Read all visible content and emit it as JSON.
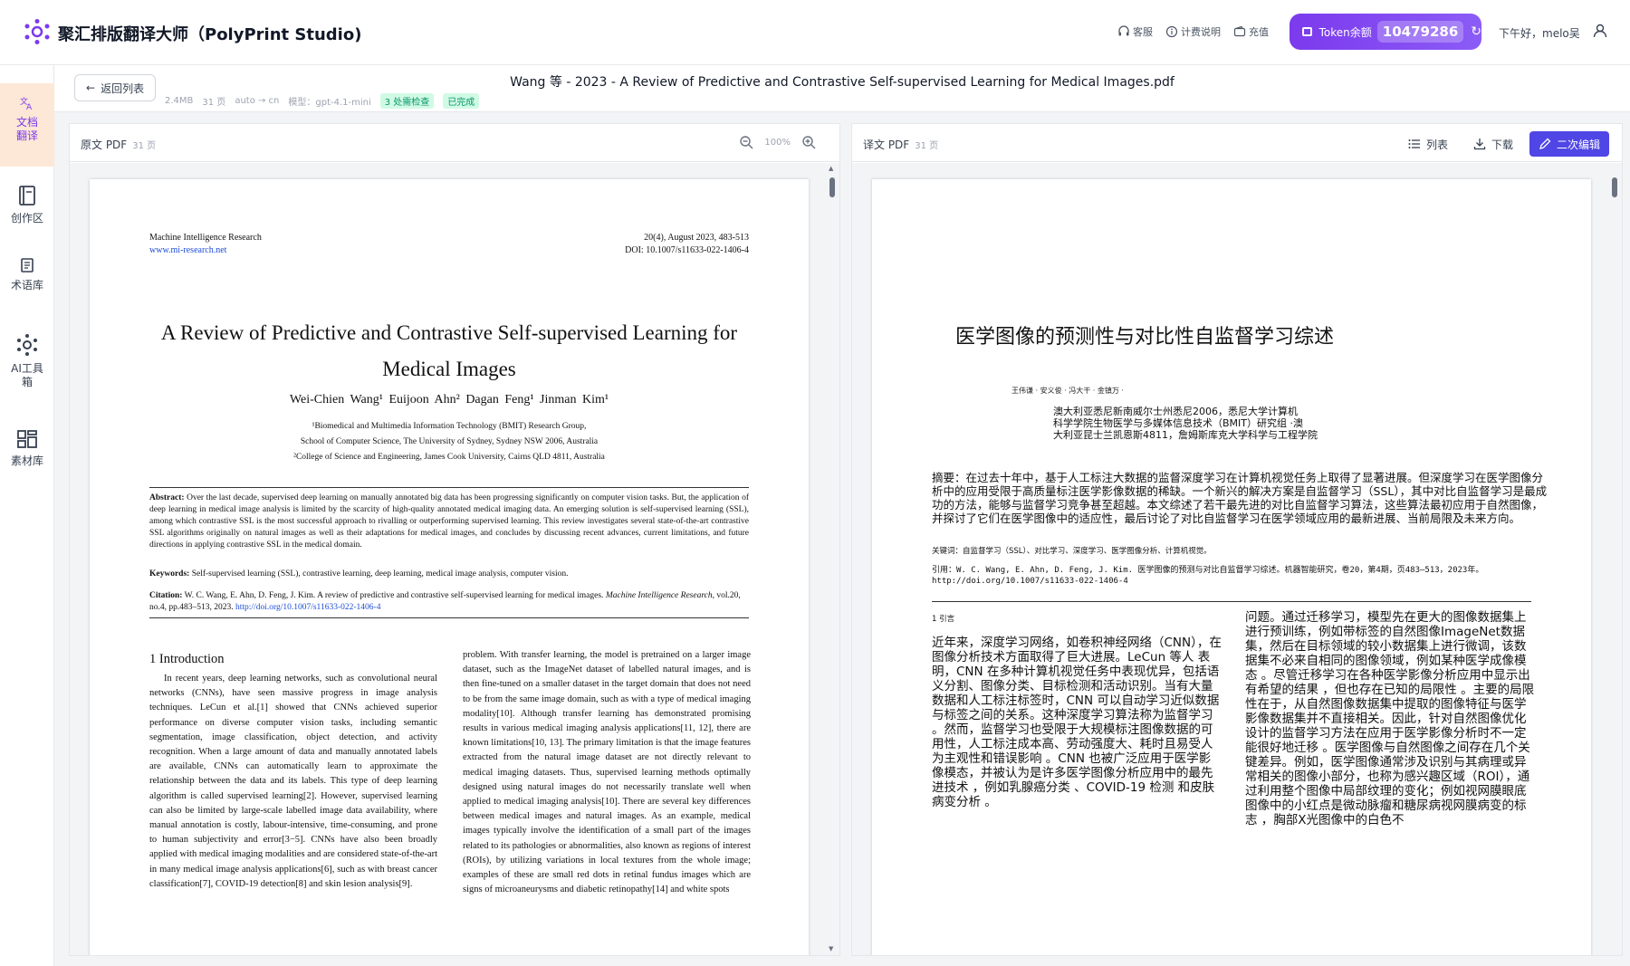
{
  "app": {
    "title": "聚汇排版翻译大师（PolyPrint Studio)",
    "links": [
      {
        "icon": "headset-icon",
        "label": "客服"
      },
      {
        "icon": "info-icon",
        "label": "计费说明"
      },
      {
        "icon": "wallet-icon",
        "label": "充值"
      }
    ],
    "token_label": "Token余额",
    "token_value": "10479286",
    "greeting": "下午好，melo吴"
  },
  "rail": [
    {
      "label": "文档翻译",
      "icon": "translate-icon",
      "active": true
    },
    {
      "label": "创作区",
      "icon": "notebook-icon"
    },
    {
      "label": "术语库",
      "icon": "glossary-icon"
    },
    {
      "label": "AI工具箱",
      "icon": "ai-tools-icon"
    },
    {
      "label": "素材库",
      "icon": "materials-icon"
    }
  ],
  "doc": {
    "back_label": "返回列表",
    "filename": "Wang 等 - 2023 - A Review of Predictive and Contrastive Self-supervised Learning for Medical Images.pdf",
    "size": "2.4MB",
    "pages": "31 页",
    "langs": "auto → cn",
    "model": "模型：gpt-4.1-mini",
    "tag_check": "3 处需检查",
    "tag_done": "已完成"
  },
  "left_panel": {
    "title": "原文 PDF",
    "pages": "31 页",
    "zoom": "100%"
  },
  "right_panel": {
    "title": "译文 PDF",
    "pages": "31 页",
    "list_label": "列表",
    "download_label": "下载",
    "edit_label": "二次编辑"
  },
  "en_page": {
    "journal": "Machine Intelligence Research",
    "url": "www.mi-research.net",
    "issue": "20(4), August 2023, 483-513",
    "doi": "DOI: 10.1007/s11633-022-1406-4",
    "title": "A Review of Predictive and Contrastive Self-supervised Learning for Medical Images",
    "authors": "Wei-Chien Wang¹      Euijoon Ahn²      Dagan Feng¹      Jinman Kim¹",
    "affil1": "¹Biomedical and Multimedia Information Technology (BMIT) Research Group,",
    "affil2": "School of Computer Science, The University of Sydney, Sydney NSW 2006, Australia",
    "affil3": "²College of Science and Engineering, James Cook University, Cairns QLD 4811, Australia",
    "abstract_label": "Abstract:",
    "abstract": "Over the last decade, supervised deep learning on manually annotated big data has been progressing significantly on computer vision tasks. But, the application of deep learning in medical image analysis is limited by the scarcity of high-quality annotated medical imaging data. An emerging solution is self-supervised learning (SSL), among which contrastive SSL is the most successful approach to rivalling or outperforming supervised learning. This review investigates several state-of-the-art contrastive SSL algorithms originally on natural images as well as their adaptations for medical images, and concludes by discussing recent advances, current limitations, and future directions in applying contrastive SSL in the medical domain.",
    "keywords_label": "Keywords:",
    "keywords": "Self-supervised learning (SSL), contrastive learning, deep learning, medical image analysis, computer vision.",
    "citation_label": "Citation:",
    "citation": "W. C. Wang, E. Ahn, D. Feng, J. Kim. A review of predictive and contrastive self-supervised learning for medical images.",
    "citation_journal": "Machine Intelligence Research",
    "citation_vol": ", vol.20, no.4, pp.483–513, 2023.",
    "citation_url": "http://doi.org/10.1007/s11633-022-1406-4",
    "section": "1   Introduction",
    "col_left": "In recent years, deep learning networks, such as convolutional neural networks (CNNs), have seen massive progress in image analysis techniques. LeCun et al.[1] showed that CNNs achieved superior performance on diverse computer vision tasks, including semantic segmentation, image classification, object detection, and activity recognition. When a large amount of data and manually annotated labels are available, CNNs can automatically learn to approximate the relationship between the data and its labels. This type of deep learning algorithm is called supervised learning[2]. However, supervised learning can also be limited by large-scale labelled image data availability, where manual annotation is costly, labour-intensive, time-consuming, and prone to human subjectivity and error[3−5]. CNNs have also been broadly applied with medical imaging modalities and are considered state-of-the-art in many medical image analysis applications[6], such as with breast cancer classification[7], COVID-19 detection[8] and skin lesion analysis[9].",
    "col_right": "problem. With transfer learning, the model is pretrained on a larger image dataset, such as the ImageNet dataset of labelled natural images, and is then fine-tuned on a smaller dataset in the target domain that does not need to be from the same image domain, such as with a type of medical imaging modality[10]. Although transfer learning has demonstrated promising results in various medical imaging analysis applications[11, 12], there are known limitations[10, 13]. The primary limitation is that the image features extracted from the natural image dataset are not directly relevant to medical imaging datasets. Thus, supervised learning methods optimally designed using natural images do not necessarily translate well when applied to medical imaging analysis[10]. There are several key differences between medical images and natural images. As an example, medical images typically involve the identification of a small part of the images related to its pathologies or abnormalities, also known as regions of interest (ROIs), by utilizing variations in local textures from the whole image; examples of these are small red dots in retinal fundus images which are signs of microaneurysms and diabetic retinopathy[14] and white spots"
  },
  "zh_page": {
    "title": "医学图像的预测性与对比性自监督学习综述",
    "authors": "王伟谦 · 安义俊 · 冯大干 · 金镇万 ·",
    "affil": "澳大利亚悉尼新南威尔士州悉尼2006，悉尼大学计算机\n科学学院生物医学与多媒体信息技术（BMIT）研究组 ·澳\n大利亚昆士兰凯恩斯4811，詹姆斯库克大学科学与工程学院",
    "abstract": "摘要：在过去十年中，基于人工标注大数据的监督深度学习在计算机视觉任务上取得了显著进展。但深度学习在医学图像分析中的应用受限于高质量标注医学影像数据的稀缺。一个新兴的解决方案是自监督学习（SSL），其中对比自监督学习是最成功的方法，能够与监督学习竞争甚至超越。本文综述了若干最先进的对比自监督学习算法，这些算法最初应用于自然图像，并探讨了它们在医学图像中的适应性，最后讨论了对比自监督学习在医学领域应用的最新进展、当前局限及未来方向。",
    "keywords": "关键词：自监督学习（SSL）、对比学习、深度学习、医学图像分析、计算机视觉。",
    "citation": "引用：W. C. Wang, E. Ahn, D. Feng, J. Kim. 医学图像的预测与对比自监督学习综述。机器智能研究，卷20，第4期，页483–513，2023年。http://doi.org/10.1007/s11633-022-1406-4",
    "section": "1 引言",
    "col_left": "近年来，深度学习网络，如卷积神经网络（CNN），在图像分析技术方面取得了巨大进展。LeCun 等人 表明，CNN 在多种计算机视觉任务中表现优异，包括语义分割、图像分类、目标检测和活动识别。当有大量数据和人工标注标签时，CNN 可以自动学习近似数据与标签之间的关系。这种深度学习算法称为监督学习 。然而，监督学习也受限于大规模标注图像数据的可用性，人工标注成本高、劳动强度大、耗时且易受人为主观性和错误影响 。CNN 也被广泛应用于医学影像模态，并被认为是许多医学图像分析应用中的最先进技术 ，例如乳腺癌分类 、COVID-19 检测 和皮肤病变分析 。",
    "col_right": "问题。通过迁移学习，模型先在更大的图像数据集上进行预训练，例如带标签的自然图像ImageNet数据集，然后在目标领域的较小数据集上进行微调，该数据集不必来自相同的图像领域，例如某种医学成像模态 。尽管迁移学习在各种医学影像分析应用中显示出有希望的结果 ，但也存在已知的局限性 。主要的局限性在于，从自然图像数据集中提取的图像特征与医学影像数据集并不直接相关。因此，针对自然图像优化设计的监督学习方法在应用于医学影像分析时不一定能很好地迁移 。医学图像与自然图像之间存在几个关键差异。例如，医学图像通常涉及识别与其病理或异常相关的图像小部分，也称为感兴趣区域（ROI），通过利用整个图像中局部纹理的变化；例如视网膜眼底图像中的小红点是微动脉瘤和糖尿病视网膜病变的标志 ，胸部X光图像中的白色不"
  }
}
